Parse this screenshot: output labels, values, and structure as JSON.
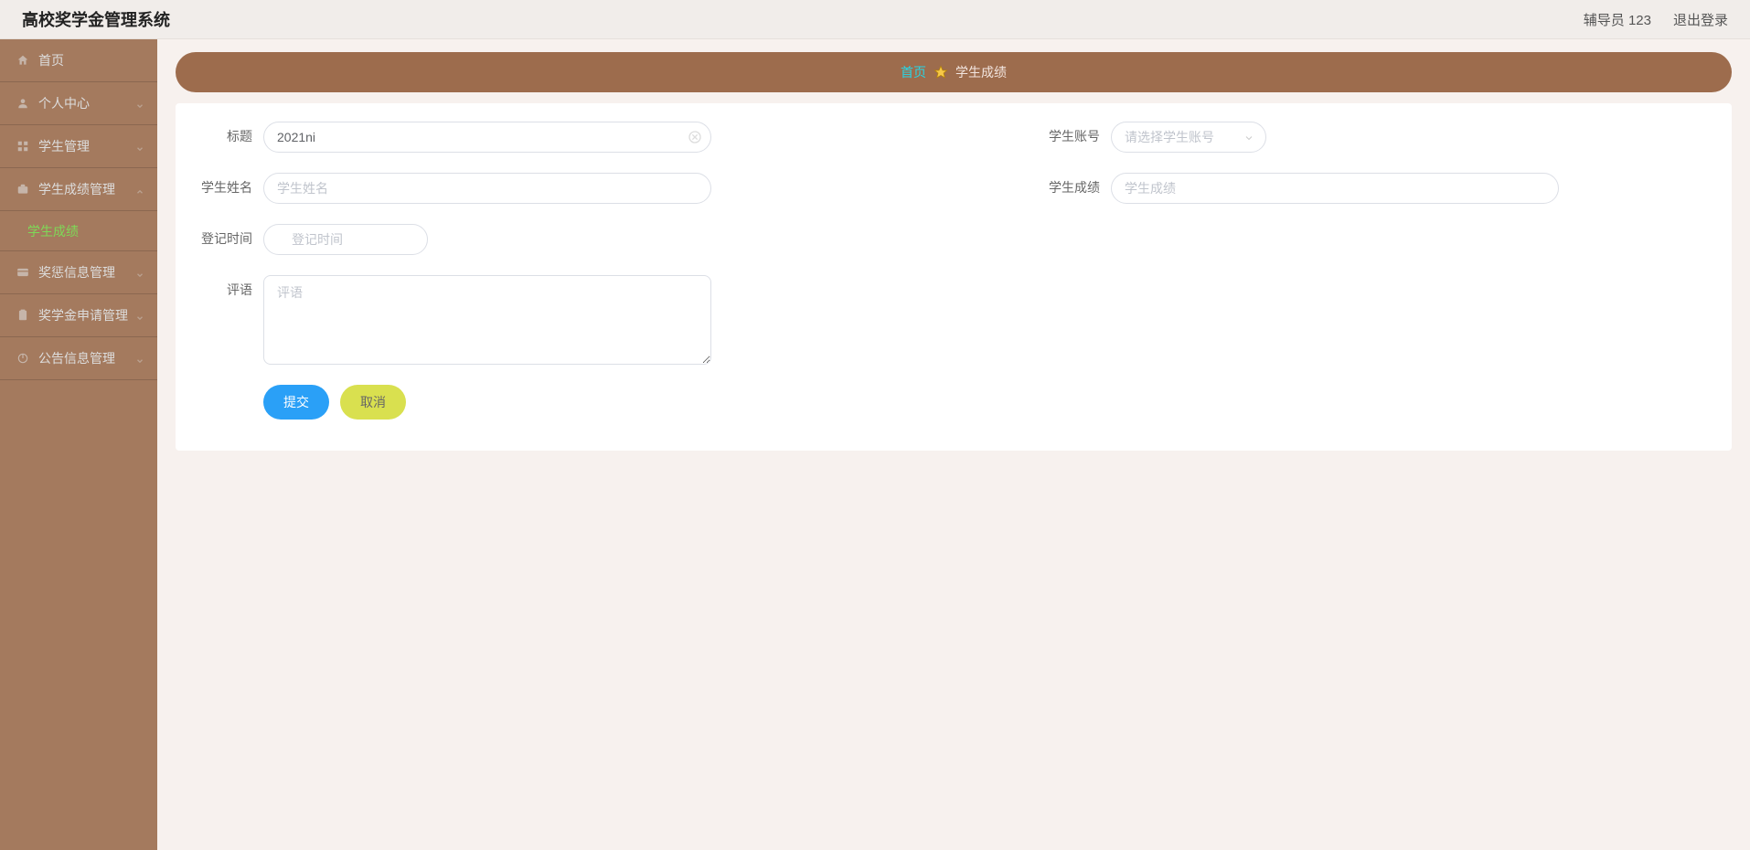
{
  "header": {
    "title": "高校奖学金管理系统",
    "user_role_label": "辅导员 123",
    "logout_label": "退出登录"
  },
  "sidebar": {
    "items": [
      {
        "label": "首页",
        "icon": "home-icon",
        "expandable": false
      },
      {
        "label": "个人中心",
        "icon": "user-icon",
        "expandable": true
      },
      {
        "label": "学生管理",
        "icon": "grid-icon",
        "expandable": true
      },
      {
        "label": "学生成绩管理",
        "icon": "briefcase-icon",
        "expandable": true,
        "expanded": true,
        "children": [
          {
            "label": "学生成绩"
          }
        ]
      },
      {
        "label": "奖惩信息管理",
        "icon": "card-icon",
        "expandable": true
      },
      {
        "label": "奖学金申请管理",
        "icon": "clipboard-icon",
        "expandable": true
      },
      {
        "label": "公告信息管理",
        "icon": "power-icon",
        "expandable": true
      }
    ]
  },
  "breadcrumb": {
    "home_label": "首页",
    "current": "学生成绩"
  },
  "form": {
    "title_label": "标题",
    "title_value": "2021ni",
    "account_label": "学生账号",
    "account_placeholder": "请选择学生账号",
    "name_label": "学生姓名",
    "name_placeholder": "学生姓名",
    "score_label": "学生成绩",
    "score_placeholder": "学生成绩",
    "time_label": "登记时间",
    "time_placeholder": "登记时间",
    "comment_label": "评语",
    "comment_placeholder": "评语",
    "submit_label": "提交",
    "cancel_label": "取消"
  }
}
